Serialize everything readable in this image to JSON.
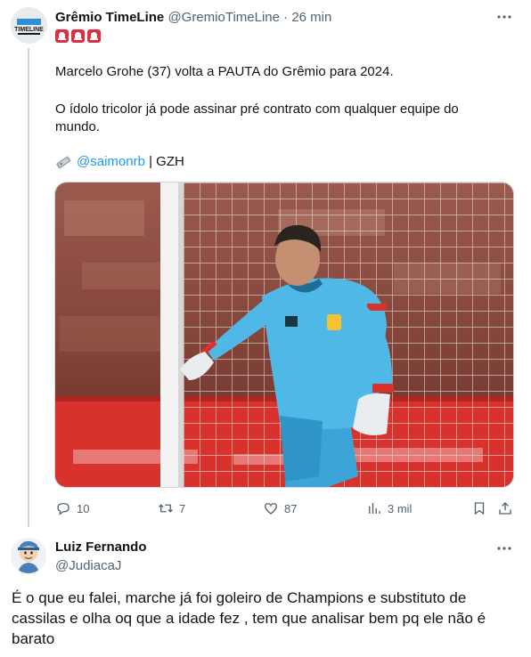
{
  "tweet": {
    "author_name": "Grêmio TimeLine",
    "author_handle": "@GremioTimeLine",
    "separator": "·",
    "time": "26 min",
    "avatar_text": "TIMELINE",
    "paragraph1": "Marcelo Grohe (37) volta a PAUTA do Grêmio para 2024.",
    "paragraph2": "O ídolo tricolor já pode assinar pré contrato com qualquer equipe do mundo.",
    "source_link": "@saimonrb",
    "source_rest": " | GZH",
    "stats": {
      "replies": "10",
      "retweets": "7",
      "likes": "87",
      "views": "3 mil"
    }
  },
  "reply": {
    "author_name": "Luiz Fernando",
    "author_handle": "@JudiacaJ",
    "text": "É o que eu falei, marche já foi goleiro de Champions e substituto de cassilas e olha oq que a idade fez , tem que analisar bem pq ele não é barato"
  },
  "colors": {
    "text_primary": "#0f1419",
    "text_secondary": "#536471",
    "link": "#1d9bf0",
    "siren": "#dd2e44",
    "jersey": "#4fb8e6"
  },
  "icons": [
    "more-icon",
    "siren-icon",
    "camera-icon",
    "reply-icon",
    "retweet-icon",
    "like-icon",
    "views-icon",
    "bookmark-icon",
    "share-icon"
  ]
}
